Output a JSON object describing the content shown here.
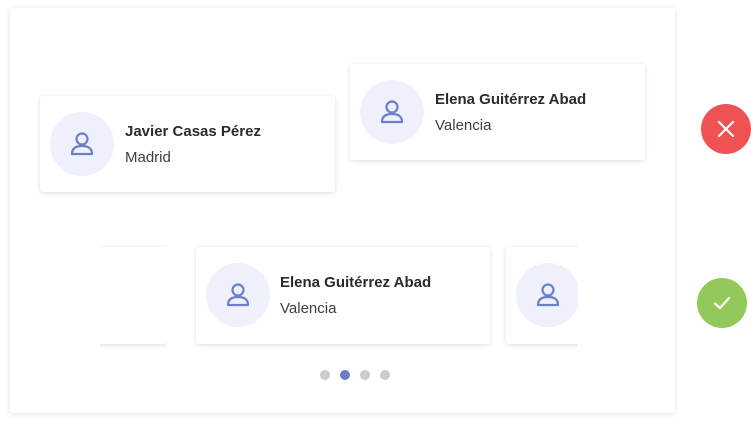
{
  "colors": {
    "avatar_bg": "#eef0fb",
    "avatar_icon": "#6b7fc9",
    "reject": "#ee5253",
    "accept": "#93c95a",
    "dot_active": "#6b7fc9",
    "dot_inactive": "#cccccc"
  },
  "top_row": {
    "cards": [
      {
        "name": "Javier Casas Pérez",
        "city": "Madrid",
        "icon": "user-icon"
      },
      {
        "name": "Elena Guitérrez Abad",
        "city": "Valencia",
        "icon": "user-icon"
      }
    ],
    "status_icon": "close-icon"
  },
  "bottom_row": {
    "cards": [
      {
        "name": "Elena Guitérrez Abad",
        "city": "Valencia",
        "icon": "user-icon"
      }
    ],
    "status_icon": "check-icon"
  },
  "pagination": {
    "total": 4,
    "active_index": 1
  }
}
